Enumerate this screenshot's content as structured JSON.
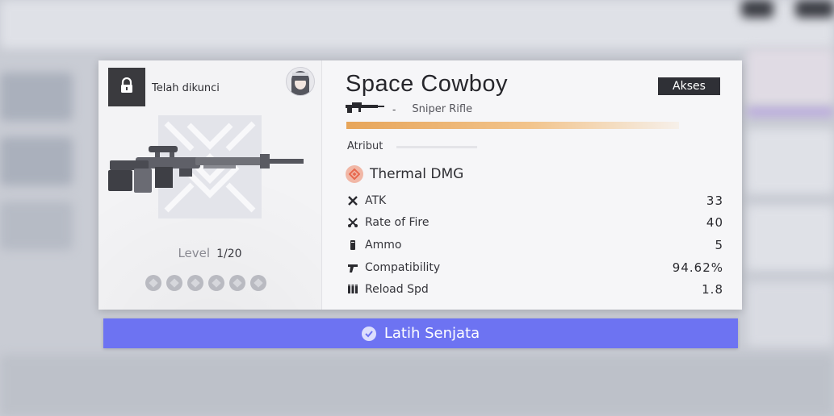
{
  "weapon": {
    "name": "Space Cowboy",
    "type": "Sniper Rifle",
    "type_separator": "-",
    "lock_status": "Telah dikunci",
    "access_label": "Akses",
    "level_label": "Level",
    "level_value": "1/20",
    "star_count": 6,
    "rarity_color": "#E7A55A"
  },
  "attributes": {
    "section_title": "Atribut",
    "element": {
      "label": "Thermal DMG",
      "icon": "thermal-diamond-icon",
      "color": "#E8694F"
    },
    "stats": [
      {
        "label": "ATK",
        "value": "33",
        "icon": "atk-icon"
      },
      {
        "label": "Rate of Fire",
        "value": "40",
        "icon": "rate-of-fire-icon"
      },
      {
        "label": "Ammo",
        "value": "5",
        "icon": "ammo-icon"
      },
      {
        "label": "Compatibility",
        "value": "94.62%",
        "icon": "compatibility-icon"
      },
      {
        "label": "Reload Spd",
        "value": "1.8",
        "icon": "reload-icon"
      }
    ]
  },
  "actions": {
    "train_label": "Latih Senjata"
  },
  "colors": {
    "accent": "#6D73F2",
    "dark": "#2F3036"
  }
}
